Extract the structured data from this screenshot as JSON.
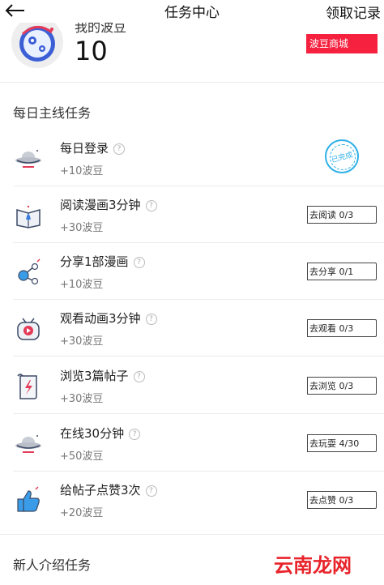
{
  "header": {
    "title": "任务中心",
    "records_label": "领取记录",
    "back_icon": "back-arrow-icon"
  },
  "summary": {
    "balance_label": "我的波豆",
    "balance": "10",
    "mall_button": "波豆商城"
  },
  "daily_section": {
    "title": "每日主线任务"
  },
  "tasks": [
    {
      "name": "每日登录",
      "reward": "+10波豆",
      "status": "已完成",
      "icon": "ufo-icon",
      "completed": true
    },
    {
      "name": "阅读漫画3分钟",
      "reward": "+30波豆",
      "action": "去阅读 0/3",
      "icon": "comic-book-icon"
    },
    {
      "name": "分享1部漫画",
      "reward": "+10波豆",
      "action": "去分享 0/1",
      "icon": "share-nodes-icon"
    },
    {
      "name": "观看动画3分钟",
      "reward": "+30波豆",
      "action": "去观看 0/3",
      "icon": "tv-robot-icon"
    },
    {
      "name": "浏览3篇帖子",
      "reward": "+30波豆",
      "action": "去浏览 0/3",
      "icon": "scroll-icon"
    },
    {
      "name": "在线30分钟",
      "reward": "+50波豆",
      "action": "去玩耍 4/30",
      "icon": "ufo-icon"
    },
    {
      "name": "给帖子点赞3次",
      "reward": "+20波豆",
      "action": "去点赞 0/3",
      "icon": "thumbs-up-icon"
    }
  ],
  "newbie_section": {
    "title": "新人介绍任务"
  },
  "watermark": "云南龙网",
  "colors": {
    "accent_red": "#f5213f",
    "stamp_blue": "#2fb0e8"
  }
}
